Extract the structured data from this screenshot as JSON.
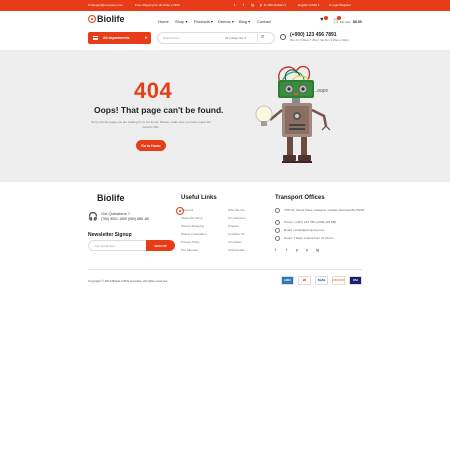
{
  "topbar": {
    "email": "Elegant@company.com",
    "promo": "Free Shipping for all Order of $99",
    "social": [
      "t",
      "f",
      "ig",
      "p"
    ],
    "currency": "$ USD (Dollar)",
    "language": "English (USD)",
    "account": "Login/Register"
  },
  "header": {
    "logo": "Biolife",
    "nav": [
      "Home",
      "Shop",
      "Products",
      "Demos",
      "Blog",
      "Contact"
    ],
    "cart_count": "0",
    "compare_count": "0",
    "cart_label": "My Cart",
    "cart_total": "$0.00",
    "colors": {
      "accent": "#e73c17"
    }
  },
  "search_row": {
    "departments": "All departments",
    "search_placeholder": "Search here...",
    "category": "All Categories",
    "phone": "(+900) 123 456 7891",
    "hours": "Mon-Fri: 8:30am-7:30pm; Sat-Sun: 9:30am-4:30pm"
  },
  "error": {
    "code": "404",
    "title": "Oops! That page can't be found.",
    "description": "Sorry, but the page you are looking for is not found. Please, make sure you have typed the current URL.",
    "button": "Go to Home",
    "oops": "...oops"
  },
  "footer": {
    "logo": "Biolife",
    "got_questions": "Got Questions ?",
    "phone": "(700) 9001-1909  (900) 689 -66",
    "newsletter_title": "Newsletter Signup",
    "newsletter_placeholder": "Your email here...",
    "newsletter_button": "SIGN UP",
    "useful_title": "Useful Links",
    "links_col1": [
      "About Us",
      "About Our Shop",
      "Secure Shopping",
      "Delivery infomation",
      "Privacy Policy",
      "Our Sitemap"
    ],
    "links_col2": [
      "Who We Are",
      "Our Services",
      "Projects",
      "Contacts Us",
      "Innovation",
      "Testimonials"
    ],
    "transport_title": "Transport Offices",
    "address": "7563 St. Vicent Place, Glasgow, Greater Newcastl 80-75005",
    "tel": "Phone: (+067) 234 789 (+068) 222 888",
    "email": "Email: contact@company.com",
    "hours": "Hours: 7 Days a week from 10:00 am",
    "transport_social": [
      "t",
      "f",
      "p",
      "y",
      "ig"
    ],
    "copyright": "Copyright © 2019 Biolife HTML template. All rights reserved.",
    "payments": [
      "AMEX",
      "MC",
      "PayPal",
      "DISCOVER",
      "VISA"
    ]
  }
}
